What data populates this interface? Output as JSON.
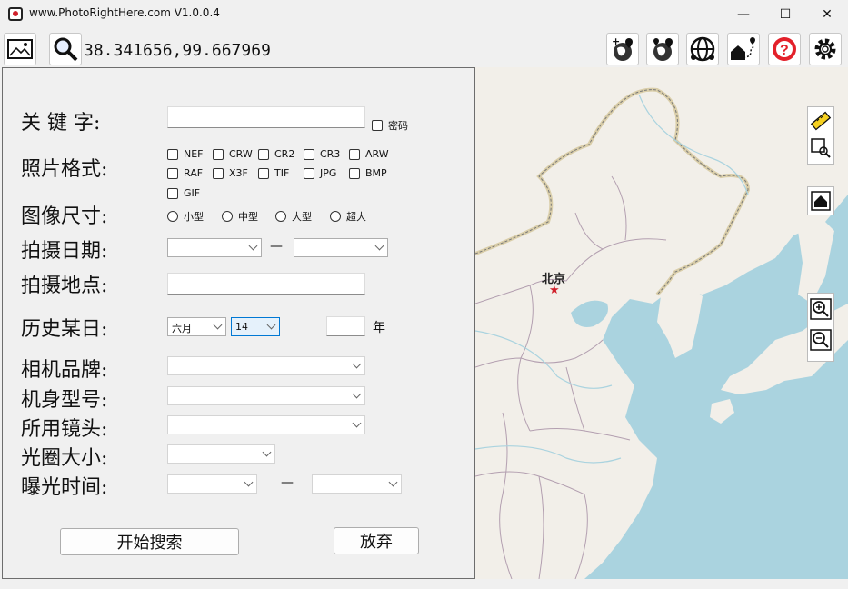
{
  "window": {
    "title": "www.PhotoRightHere.com V1.0.0.4",
    "minimize_glyph": "—",
    "maximize_glyph": "☐",
    "close_glyph": "✕"
  },
  "toolbar": {
    "coordinates": "38.341656,99.667969",
    "left_icons": [
      "image-icon",
      "search-icon"
    ],
    "right_icons": [
      "globe-add-icon",
      "globe-pins-icon",
      "network-globe-icon",
      "home-route-icon",
      "help-icon",
      "settings-icon"
    ]
  },
  "search": {
    "keyword_label": "关 键 字:",
    "password_label": "密码",
    "format_label": "照片格式:",
    "formats": [
      "NEF",
      "CRW",
      "CR2",
      "CR3",
      "ARW",
      "RAF",
      "X3F",
      "TIF",
      "JPG",
      "BMP",
      "GIF"
    ],
    "size_label": "图像尺寸:",
    "sizes": [
      "小型",
      "中型",
      "大型",
      "超大"
    ],
    "date_label": "拍摄日期:",
    "date_separator": "—",
    "location_label": "拍摄地点:",
    "history_label": "历史某日:",
    "history_month": "六月",
    "history_day": "14",
    "year_unit": "年",
    "brand_label": "相机品牌:",
    "model_label": "机身型号:",
    "lens_label": "所用镜头:",
    "aperture_label": "光圈大小:",
    "exposure_label": "曝光时间:",
    "exposure_separator": "—",
    "start_button": "开始搜索",
    "cancel_button": "放弃"
  },
  "map": {
    "capital_label": "北京",
    "capital_marker": "★",
    "tools": [
      "ruler-icon",
      "zoom-region-icon",
      "home-icon",
      "zoom-in-icon",
      "zoom-out-icon"
    ],
    "colors": {
      "water": "#aad3df",
      "land": "#f2efe9",
      "border": "#b39fb0",
      "disputed": "#c9b77f"
    }
  }
}
